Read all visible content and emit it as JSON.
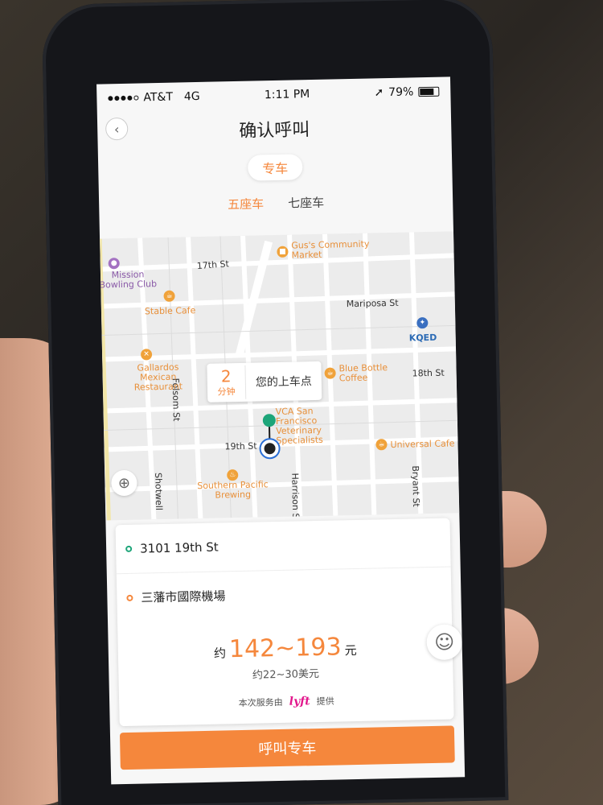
{
  "status_bar": {
    "carrier": "AT&T",
    "network": "4G",
    "time": "1:11 PM",
    "battery": "79%",
    "battery_level": 0.79
  },
  "header": {
    "title": "确认呼叫",
    "back_icon": "chevron-left-icon"
  },
  "service_type": "专车",
  "seat_tabs": [
    {
      "label": "五座车",
      "active": true
    },
    {
      "label": "七座车",
      "active": false
    }
  ],
  "map": {
    "streets": [
      "17th St",
      "Mariposa St",
      "18th St",
      "19th St",
      "Folsom St",
      "Harrison St",
      "Bryant St",
      "Shotwell"
    ],
    "places": [
      "Gus's Community Market",
      "Mission Bowling Club",
      "Stable Cafe",
      "Gallardos Mexican Restaurant",
      "KQED",
      "Blue Bottle Coffee",
      "VCA San Francisco Veterinary Specialists",
      "Universal Cafe",
      "Southern Pacific Brewing"
    ],
    "eta_minutes": "2",
    "eta_unit": "分钟",
    "pickup_label": "您的上车点"
  },
  "trip": {
    "origin": "3101 19th St",
    "destination": "三藩市國際機場",
    "fare_prefix": "约",
    "fare_range": "142~193",
    "fare_unit": "元",
    "fare_usd": "约22~30美元",
    "provider_prefix": "本次服务由",
    "provider_name": "lyft",
    "provider_suffix": "提供"
  },
  "call_button": "呼叫专车",
  "colors": {
    "accent": "#f5873c",
    "green": "#1da579",
    "lyft": "#e2178c"
  }
}
